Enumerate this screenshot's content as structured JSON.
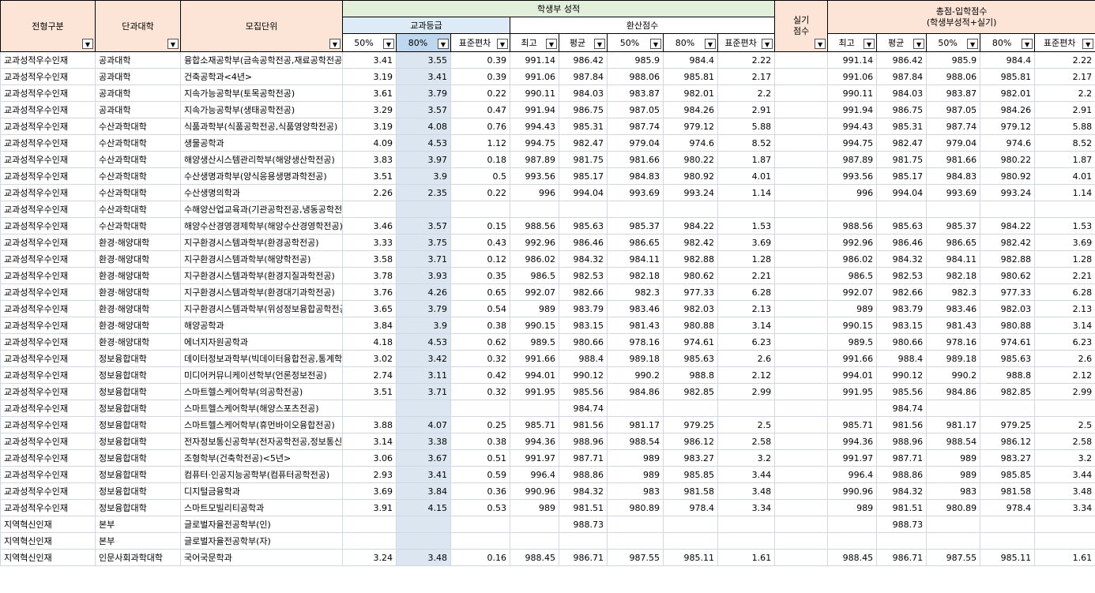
{
  "headers": {
    "type": "전형구분",
    "college": "단과대학",
    "unit": "모집단위",
    "record": "학생부 성적",
    "grade": "교과등급",
    "converted": "환산점수",
    "practical_line1": "실기",
    "practical_line2": "점수",
    "total_line1": "총점-입학점수",
    "total_line2": "(학생부성적+실기)",
    "filter_icon": "▼",
    "grade_cols": [
      "50%",
      "80%",
      "표준편차"
    ],
    "conv_cols": [
      "최고",
      "평균",
      "50%",
      "80%",
      "표준편차"
    ],
    "total_cols": [
      "최고",
      "평균",
      "50%",
      "80%",
      "표준편차"
    ]
  },
  "rows": [
    [
      "교과성적우수인재",
      "공과대학",
      "융합소재공학부(금속공학전공,재료공학전공)",
      "3.41",
      "3.55",
      "0.39",
      "991.14",
      "986.42",
      "985.9",
      "984.4",
      "2.22",
      "",
      "991.14",
      "986.42",
      "985.9",
      "984.4",
      "2.22"
    ],
    [
      "교과성적우수인재",
      "공과대학",
      "건축공학과<4년>",
      "3.19",
      "3.41",
      "0.39",
      "991.06",
      "987.84",
      "988.06",
      "985.81",
      "2.17",
      "",
      "991.06",
      "987.84",
      "988.06",
      "985.81",
      "2.17"
    ],
    [
      "교과성적우수인재",
      "공과대학",
      "지속가능공학부(토목공학전공)",
      "3.61",
      "3.79",
      "0.22",
      "990.11",
      "984.03",
      "983.87",
      "982.01",
      "2.2",
      "",
      "990.11",
      "984.03",
      "983.87",
      "982.01",
      "2.2"
    ],
    [
      "교과성적우수인재",
      "공과대학",
      "지속가능공학부(생태공학전공)",
      "3.29",
      "3.57",
      "0.47",
      "991.94",
      "986.75",
      "987.05",
      "984.26",
      "2.91",
      "",
      "991.94",
      "986.75",
      "987.05",
      "984.26",
      "2.91"
    ],
    [
      "교과성적우수인재",
      "수산과학대학",
      "식품과학부(식품공학전공,식품영양학전공)",
      "3.19",
      "4.08",
      "0.76",
      "994.43",
      "985.31",
      "987.74",
      "979.12",
      "5.88",
      "",
      "994.43",
      "985.31",
      "987.74",
      "979.12",
      "5.88"
    ],
    [
      "교과성적우수인재",
      "수산과학대학",
      "생물공학과",
      "4.09",
      "4.53",
      "1.12",
      "994.75",
      "982.47",
      "979.04",
      "974.6",
      "8.52",
      "",
      "994.75",
      "982.47",
      "979.04",
      "974.6",
      "8.52"
    ],
    [
      "교과성적우수인재",
      "수산과학대학",
      "해양생산시스템관리학부(해양생산학전공)",
      "3.83",
      "3.97",
      "0.18",
      "987.89",
      "981.75",
      "981.66",
      "980.22",
      "1.87",
      "",
      "987.89",
      "981.75",
      "981.66",
      "980.22",
      "1.87"
    ],
    [
      "교과성적우수인재",
      "수산과학대학",
      "수산생명과학부(양식응용생명과학전공)",
      "3.51",
      "3.9",
      "0.5",
      "993.56",
      "985.17",
      "984.83",
      "980.92",
      "4.01",
      "",
      "993.56",
      "985.17",
      "984.83",
      "980.92",
      "4.01"
    ],
    [
      "교과성적우수인재",
      "수산과학대학",
      "수산생명의학과",
      "2.26",
      "2.35",
      "0.22",
      "996",
      "994.04",
      "993.69",
      "993.24",
      "1.14",
      "",
      "996",
      "994.04",
      "993.69",
      "993.24",
      "1.14"
    ],
    [
      "교과성적우수인재",
      "수산과학대학",
      "수해양산업교육과(기관공학전공,냉동공학전공)",
      "",
      "",
      "",
      "",
      "",
      "",
      "",
      "",
      "",
      "",
      "",
      "",
      "",
      ""
    ],
    [
      "교과성적우수인재",
      "수산과학대학",
      "해양수산경영경제학부(해양수산경영학전공)",
      "3.46",
      "3.57",
      "0.15",
      "988.56",
      "985.63",
      "985.37",
      "984.22",
      "1.53",
      "",
      "988.56",
      "985.63",
      "985.37",
      "984.22",
      "1.53"
    ],
    [
      "교과성적우수인재",
      "환경·해양대학",
      "지구환경시스템과학부(환경공학전공)",
      "3.33",
      "3.75",
      "0.43",
      "992.96",
      "986.46",
      "986.65",
      "982.42",
      "3.69",
      "",
      "992.96",
      "986.46",
      "986.65",
      "982.42",
      "3.69"
    ],
    [
      "교과성적우수인재",
      "환경·해양대학",
      "지구환경시스템과학부(해양학전공)",
      "3.58",
      "3.71",
      "0.12",
      "986.02",
      "984.32",
      "984.11",
      "982.88",
      "1.28",
      "",
      "986.02",
      "984.32",
      "984.11",
      "982.88",
      "1.28"
    ],
    [
      "교과성적우수인재",
      "환경·해양대학",
      "지구환경시스템과학부(환경지질과학전공)",
      "3.78",
      "3.93",
      "0.35",
      "986.5",
      "982.53",
      "982.18",
      "980.62",
      "2.21",
      "",
      "986.5",
      "982.53",
      "982.18",
      "980.62",
      "2.21"
    ],
    [
      "교과성적우수인재",
      "환경·해양대학",
      "지구환경시스템과학부(환경대기과학전공)",
      "3.76",
      "4.26",
      "0.65",
      "992.07",
      "982.66",
      "982.3",
      "977.33",
      "6.28",
      "",
      "992.07",
      "982.66",
      "982.3",
      "977.33",
      "6.28"
    ],
    [
      "교과성적우수인재",
      "환경·해양대학",
      "지구환경시스템과학부(위성정보융합공학전공)",
      "3.65",
      "3.79",
      "0.54",
      "989",
      "983.79",
      "983.46",
      "982.03",
      "2.13",
      "",
      "989",
      "983.79",
      "983.46",
      "982.03",
      "2.13"
    ],
    [
      "교과성적우수인재",
      "환경·해양대학",
      "해양공학과",
      "3.84",
      "3.9",
      "0.38",
      "990.15",
      "983.15",
      "981.43",
      "980.88",
      "3.14",
      "",
      "990.15",
      "983.15",
      "981.43",
      "980.88",
      "3.14"
    ],
    [
      "교과성적우수인재",
      "환경·해양대학",
      "에너지자원공학과",
      "4.18",
      "4.53",
      "0.62",
      "989.5",
      "980.66",
      "978.16",
      "974.61",
      "6.23",
      "",
      "989.5",
      "980.66",
      "978.16",
      "974.61",
      "6.23"
    ],
    [
      "교과성적우수인재",
      "정보융합대학",
      "데이터정보과학부(빅데이터융합전공,통계학전공)",
      "3.02",
      "3.42",
      "0.32",
      "991.66",
      "988.4",
      "989.18",
      "985.63",
      "2.6",
      "",
      "991.66",
      "988.4",
      "989.18",
      "985.63",
      "2.6"
    ],
    [
      "교과성적우수인재",
      "정보융합대학",
      "미디어커뮤니케이션학부(언론정보전공)",
      "2.74",
      "3.11",
      "0.42",
      "994.01",
      "990.12",
      "990.2",
      "988.8",
      "2.12",
      "",
      "994.01",
      "990.12",
      "990.2",
      "988.8",
      "2.12"
    ],
    [
      "교과성적우수인재",
      "정보융합대학",
      "스마트헬스케어학부(의공학전공)",
      "3.51",
      "3.71",
      "0.32",
      "991.95",
      "985.56",
      "984.86",
      "982.85",
      "2.99",
      "",
      "991.95",
      "985.56",
      "984.86",
      "982.85",
      "2.99"
    ],
    [
      "교과성적우수인재",
      "정보융합대학",
      "스마트헬스케어학부(해양스포츠전공)",
      "",
      "",
      "",
      "",
      "984.74",
      "",
      "",
      "",
      "",
      "",
      "984.74",
      "",
      "",
      ""
    ],
    [
      "교과성적우수인재",
      "정보융합대학",
      "스마트헬스케어학부(휴먼바이오융합전공)",
      "3.88",
      "4.07",
      "0.25",
      "985.71",
      "981.56",
      "981.17",
      "979.25",
      "2.5",
      "",
      "985.71",
      "981.56",
      "981.17",
      "979.25",
      "2.5"
    ],
    [
      "교과성적우수인재",
      "정보융합대학",
      "전자정보통신공학부(전자공학전공,정보통신공학전공)",
      "3.14",
      "3.38",
      "0.38",
      "994.36",
      "988.96",
      "988.54",
      "986.12",
      "2.58",
      "",
      "994.36",
      "988.96",
      "988.54",
      "986.12",
      "2.58"
    ],
    [
      "교과성적우수인재",
      "정보융합대학",
      "조형학부(건축학전공)<5년>",
      "3.06",
      "3.67",
      "0.51",
      "991.97",
      "987.71",
      "989",
      "983.27",
      "3.2",
      "",
      "991.97",
      "987.71",
      "989",
      "983.27",
      "3.2"
    ],
    [
      "교과성적우수인재",
      "정보융합대학",
      "컴퓨터·인공지능공학부(컴퓨터공학전공)",
      "2.93",
      "3.41",
      "0.59",
      "996.4",
      "988.86",
      "989",
      "985.85",
      "3.44",
      "",
      "996.4",
      "988.86",
      "989",
      "985.85",
      "3.44"
    ],
    [
      "교과성적우수인재",
      "정보융합대학",
      "디지털금융학과",
      "3.69",
      "3.84",
      "0.36",
      "990.96",
      "984.32",
      "983",
      "981.58",
      "3.48",
      "",
      "990.96",
      "984.32",
      "983",
      "981.58",
      "3.48"
    ],
    [
      "교과성적우수인재",
      "정보융합대학",
      "스마트모빌리티공학과",
      "3.91",
      "4.15",
      "0.53",
      "989",
      "981.51",
      "980.89",
      "978.4",
      "3.34",
      "",
      "989",
      "981.51",
      "980.89",
      "978.4",
      "3.34"
    ],
    [
      "지역혁신인재",
      "본부",
      "글로벌자율전공학부(인)",
      "",
      "",
      "",
      "",
      "988.73",
      "",
      "",
      "",
      "",
      "",
      "988.73",
      "",
      "",
      ""
    ],
    [
      "지역혁신인재",
      "본부",
      "글로벌자율전공학부(자)",
      "",
      "",
      "",
      "",
      "",
      "",
      "",
      "",
      "",
      "",
      "",
      "",
      "",
      ""
    ],
    [
      "지역혁신인재",
      "인문사회과학대학",
      "국어국문학과",
      "3.24",
      "3.48",
      "0.16",
      "988.45",
      "986.71",
      "987.55",
      "985.11",
      "1.61",
      "",
      "988.45",
      "986.71",
      "987.55",
      "985.11",
      "1.61"
    ]
  ]
}
